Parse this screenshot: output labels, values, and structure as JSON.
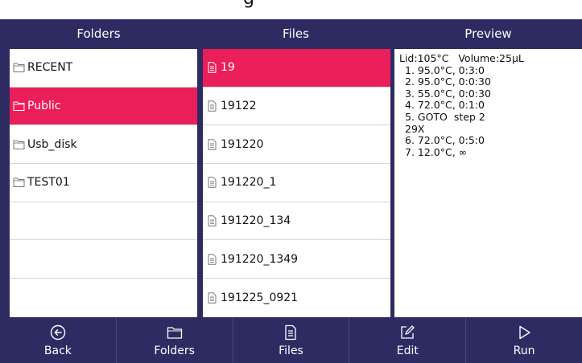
{
  "window_title": "g",
  "header": {
    "folders": "Folders",
    "files": "Files",
    "preview": "Preview"
  },
  "folders": [
    {
      "label": "RECENT",
      "selected": false
    },
    {
      "label": "Public",
      "selected": true
    },
    {
      "label": "Usb_disk",
      "selected": false
    },
    {
      "label": "TEST01",
      "selected": false
    },
    {
      "label": "",
      "selected": false
    },
    {
      "label": "",
      "selected": false
    },
    {
      "label": "",
      "selected": false
    }
  ],
  "files": [
    {
      "label": "19",
      "selected": true
    },
    {
      "label": "19122",
      "selected": false
    },
    {
      "label": "191220",
      "selected": false
    },
    {
      "label": "191220_1",
      "selected": false
    },
    {
      "label": "191220_134",
      "selected": false
    },
    {
      "label": "191220_1349",
      "selected": false
    },
    {
      "label": "191225_0921",
      "selected": false
    }
  ],
  "preview": {
    "lines": [
      "Lid:105°C   Volume:25μL",
      "1. 95.0°C, 0:3:0",
      "2. 95.0°C, 0:0:30",
      "3. 55.0°C, 0:0:30",
      "4. 72.0°C, 0:1:0",
      "5. GOTO  step 2",
      "29X",
      "6. 72.0°C, 0:5:0",
      "7. 12.0°C, ∞"
    ]
  },
  "toolbar": {
    "back": "Back",
    "folders": "Folders",
    "files": "Files",
    "edit": "Edit",
    "run": "Run"
  },
  "colors": {
    "frame": "#2d2b62",
    "selected": "#ea1e59",
    "panel": "#ffffff"
  },
  "icons": {
    "folder": "folder-icon",
    "file": "file-icon",
    "back": "back-circle-icon",
    "edit": "edit-icon",
    "run": "play-icon"
  }
}
